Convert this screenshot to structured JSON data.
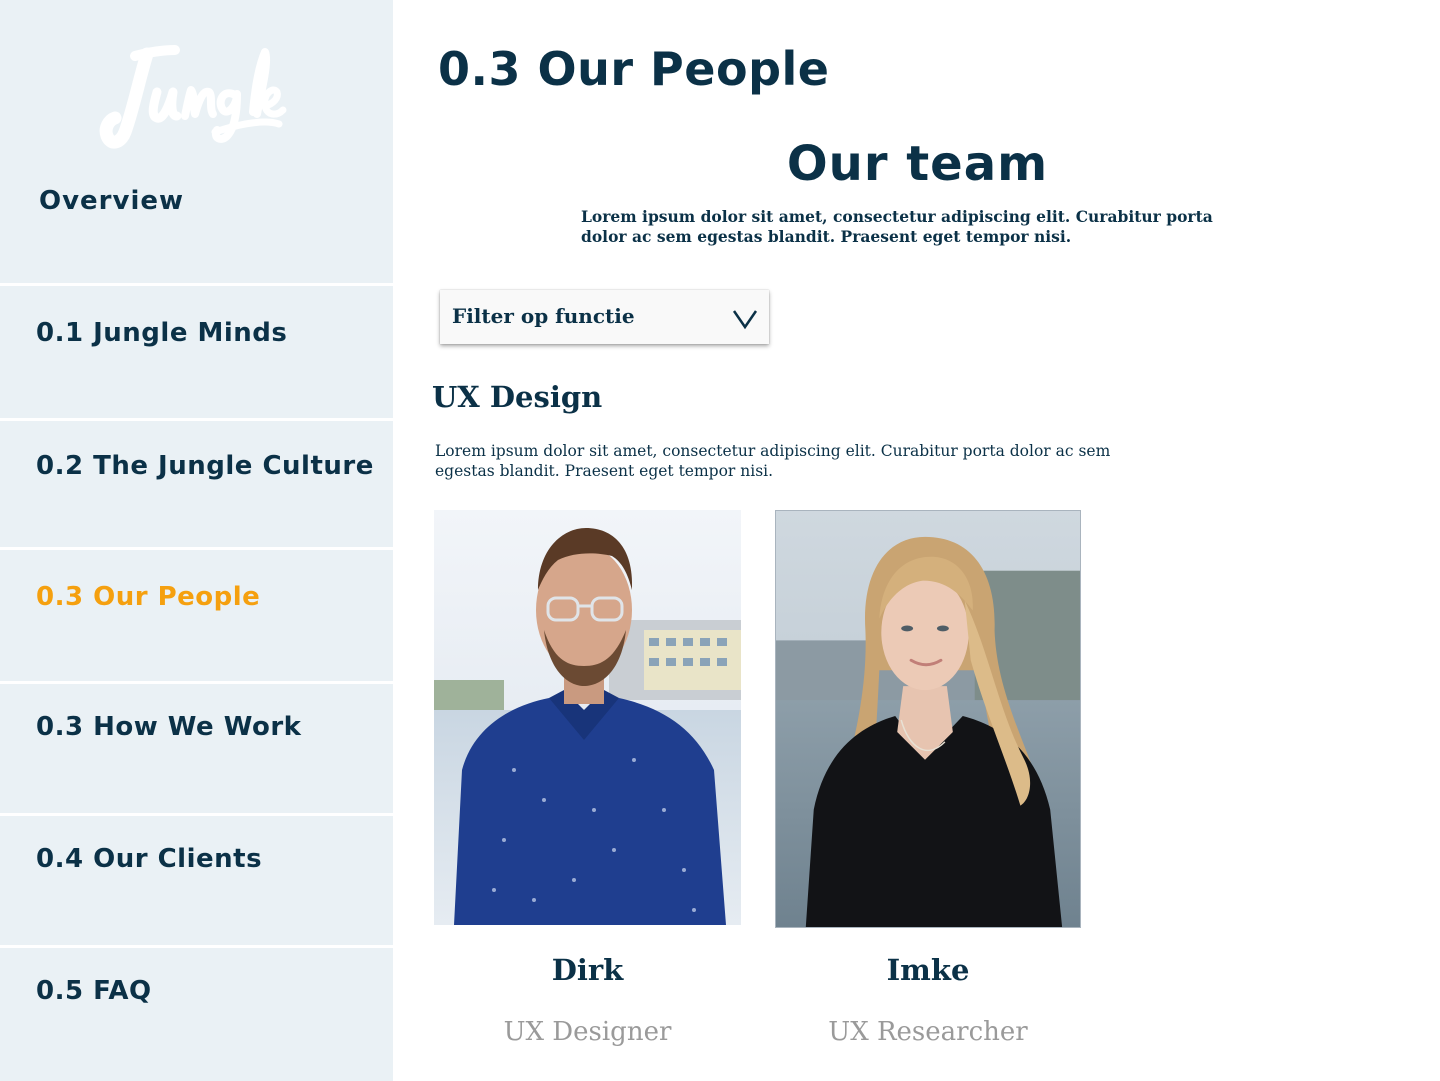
{
  "brand": {
    "logo_text": "Jungle"
  },
  "sidebar": {
    "overview_label": "Overview",
    "items": [
      {
        "label": "0.1 Jungle Minds",
        "active": false
      },
      {
        "label": "0.2 The Jungle Culture",
        "active": false
      },
      {
        "label": "0.3 Our People",
        "active": true
      },
      {
        "label": "0.3 How We Work",
        "active": false
      },
      {
        "label": "0.4 Our Clients",
        "active": false
      },
      {
        "label": "0.5 FAQ",
        "active": false
      }
    ]
  },
  "main": {
    "page_title": "0.3 Our People",
    "team_title": "Our team",
    "team_intro": "Lorem ipsum dolor sit amet, consectetur adipiscing elit. Curabitur porta dolor ac sem egestas blandit. Praesent eget tempor nisi.",
    "filter": {
      "label": "Filter op functie",
      "icon": "chevron-down-icon"
    },
    "section": {
      "title": "UX Design",
      "description": "Lorem ipsum dolor sit amet, consectetur adipiscing elit. Curabitur porta dolor ac sem egestas blandit. Praesent eget tempor nisi."
    },
    "people": [
      {
        "name": "Dirk",
        "role": "UX Designer"
      },
      {
        "name": "Imke",
        "role": "UX Researcher"
      }
    ]
  },
  "colors": {
    "sidebar_bg": "#eaf1f5",
    "text_dark": "#0b3147",
    "accent_active": "#f5a00f",
    "role_gray": "#9a9a9a"
  }
}
